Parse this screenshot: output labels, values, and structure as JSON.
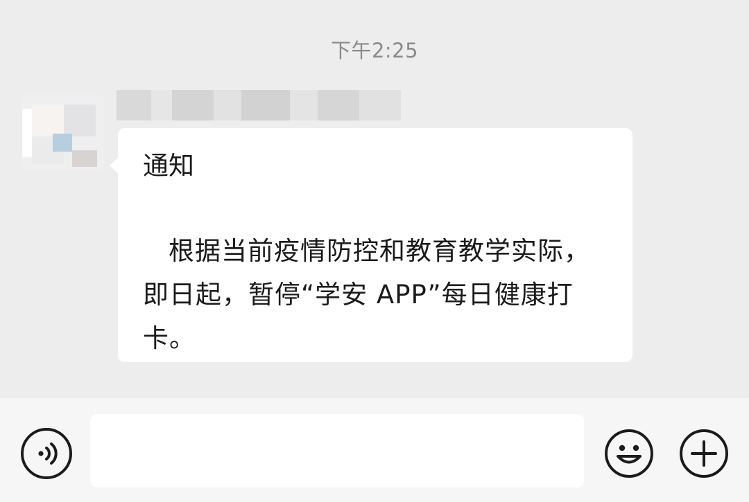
{
  "chat": {
    "timestamp": "下午2:25",
    "message": {
      "title": "通知",
      "body": "根据当前疫情防控和教育教学实际，即日起，暂停“学安 APP”每日健康打卡。"
    }
  },
  "input_bar": {
    "placeholder": "",
    "voice_icon": "voice-icon",
    "emoji_icon": "emoji-icon",
    "plus_icon": "plus-icon"
  },
  "colors": {
    "background": "#ededed",
    "bubble": "#ffffff",
    "timestamp": "#8a8a8a",
    "text": "#1b1b1b"
  }
}
